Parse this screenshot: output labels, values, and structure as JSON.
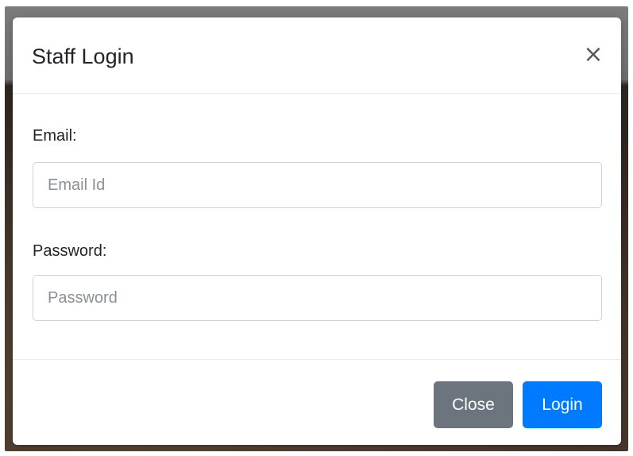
{
  "modal": {
    "title": "Staff Login",
    "close_icon_glyph": "×"
  },
  "form": {
    "email_label": "Email:",
    "email_placeholder": "Email Id",
    "email_value": "",
    "password_label": "Password:",
    "password_placeholder": "Password",
    "password_value": ""
  },
  "footer": {
    "close_label": "Close",
    "login_label": "Login"
  },
  "icons": {
    "close": "close-icon"
  },
  "colors": {
    "close_button": "#6c757d",
    "login_button": "#007bff"
  }
}
